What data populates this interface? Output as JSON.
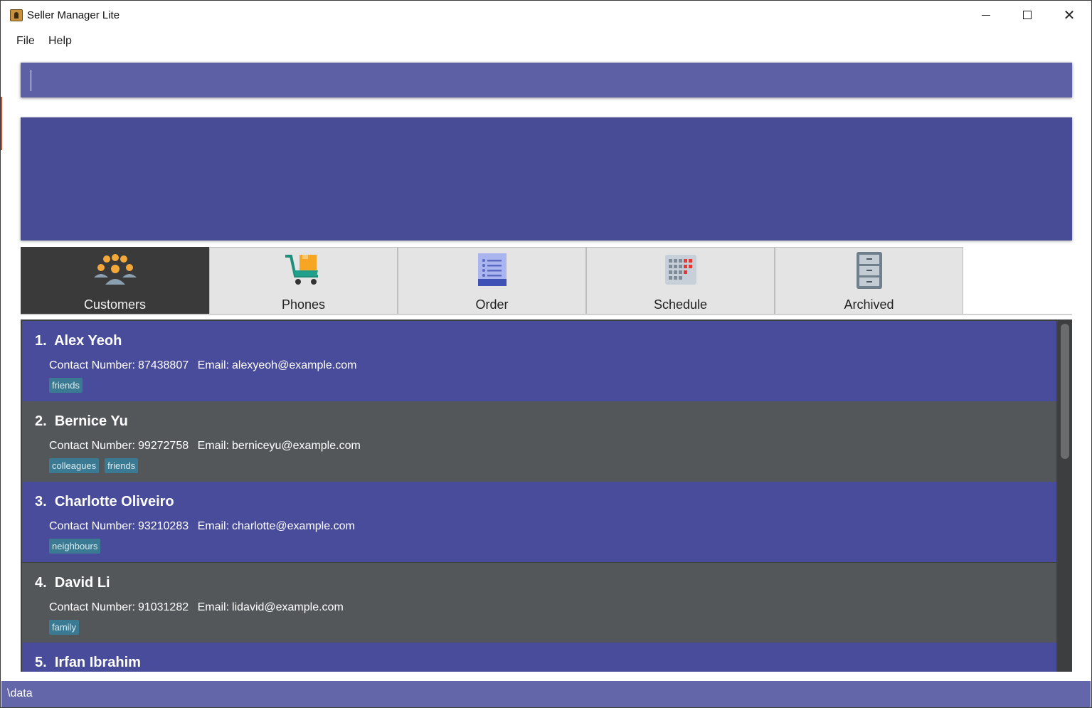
{
  "window": {
    "title": "Seller Manager Lite",
    "minimize_glyph": "—",
    "maximize_glyph": "□",
    "close_glyph": "✕"
  },
  "menu": {
    "items": [
      {
        "label": "File"
      },
      {
        "label": "Help"
      }
    ]
  },
  "command": {
    "value": "",
    "placeholder": ""
  },
  "result": {
    "text": ""
  },
  "tabs": [
    {
      "label": "Customers",
      "icon": "people-icon",
      "active": true
    },
    {
      "label": "Phones",
      "icon": "cart-icon",
      "active": false
    },
    {
      "label": "Order",
      "icon": "receipt-icon",
      "active": false
    },
    {
      "label": "Schedule",
      "icon": "calendar-icon",
      "active": false
    },
    {
      "label": "Archived",
      "icon": "cabinet-icon",
      "active": false
    }
  ],
  "customers": [
    {
      "index": "1.",
      "name": "Alex Yeoh",
      "contact_label": "Contact Number:",
      "contact": "87438807",
      "email_label": "Email:",
      "email": "alexyeoh@example.com",
      "tags": [
        "friends"
      ]
    },
    {
      "index": "2.",
      "name": "Bernice Yu",
      "contact_label": "Contact Number:",
      "contact": "99272758",
      "email_label": "Email:",
      "email": "berniceyu@example.com",
      "tags": [
        "colleagues",
        "friends"
      ]
    },
    {
      "index": "3.",
      "name": "Charlotte Oliveiro",
      "contact_label": "Contact Number:",
      "contact": "93210283",
      "email_label": "Email:",
      "email": "charlotte@example.com",
      "tags": [
        "neighbours"
      ]
    },
    {
      "index": "4.",
      "name": "David Li",
      "contact_label": "Contact Number:",
      "contact": "91031282",
      "email_label": "Email:",
      "email": "lidavid@example.com",
      "tags": [
        "family"
      ]
    },
    {
      "index": "5.",
      "name": "Irfan Ibrahim"
    }
  ],
  "status": {
    "path": "\\data"
  },
  "colors": {
    "command_bg": "#5e60a6",
    "result_bg": "#484c96",
    "card_odd": "#484c9b",
    "card_even": "#53575a",
    "tag_bg": "#3a7a92",
    "status_bg": "#6466aa"
  }
}
